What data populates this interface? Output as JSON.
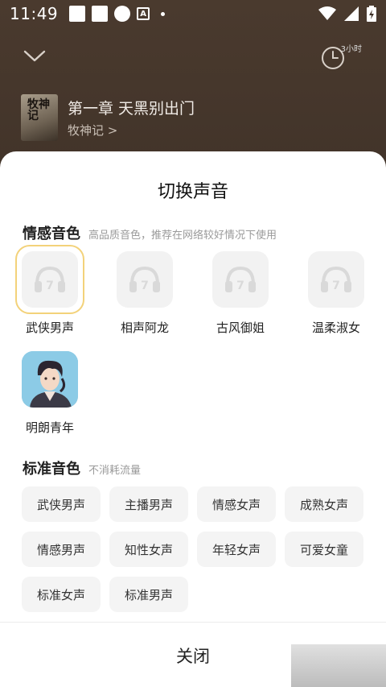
{
  "status": {
    "time": "11:49",
    "a_label": "A"
  },
  "header": {
    "timer_label": "3小时"
  },
  "now_playing": {
    "cover_text": "牧神记",
    "title": "第一章 天黑别出门",
    "author": "牧神记 >"
  },
  "sheet": {
    "title": "切换声音",
    "emotional": {
      "title": "情感音色",
      "subtitle": "高品质音色，推荐在网络较好情况下使用",
      "voices": [
        {
          "label": "武侠男声",
          "selected": true
        },
        {
          "label": "相声阿龙"
        },
        {
          "label": "古风御姐"
        },
        {
          "label": "温柔淑女"
        },
        {
          "label": "明朗青年"
        }
      ]
    },
    "standard": {
      "title": "标准音色",
      "subtitle": "不消耗流量",
      "chips": [
        "武侠男声",
        "主播男声",
        "情感女声",
        "成熟女声",
        "情感男声",
        "知性女声",
        "年轻女声",
        "可爱女童",
        "标准女声",
        "标准男声"
      ]
    },
    "close_label": "关闭"
  },
  "colors": {
    "selected_ring": "#f3d27a",
    "chip_bg": "#f4f4f4"
  }
}
